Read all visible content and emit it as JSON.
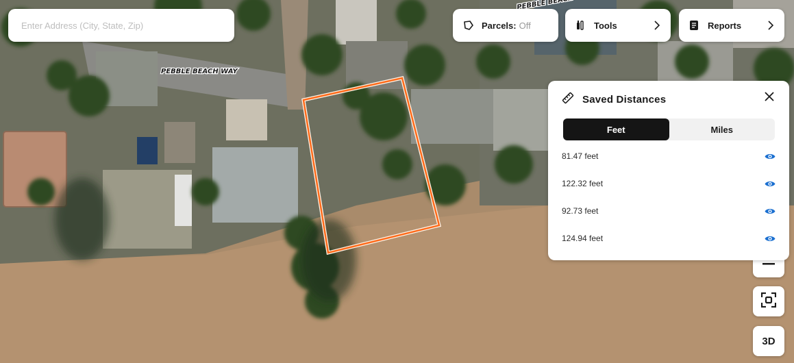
{
  "search": {
    "placeholder": "Enter Address (City, State, Zip)",
    "value": ""
  },
  "toolbar": {
    "parcels_label": "Parcels:",
    "parcels_state": "Off",
    "tools_label": "Tools",
    "reports_label": "Reports"
  },
  "map": {
    "street_label": "PEBBLE BEACH WAY",
    "street_label_2": "PEBBLE BEACH",
    "parcel_outline_color": "#ff6a1a"
  },
  "saved_distances": {
    "title": "Saved Distances",
    "units": [
      "Feet",
      "Miles"
    ],
    "active_unit": "Feet",
    "items": [
      {
        "label": "81.47 feet"
      },
      {
        "label": "122.32 feet"
      },
      {
        "label": "92.73 feet"
      },
      {
        "label": "124.94 feet"
      }
    ],
    "eye_icon_color": "#1a6fd0"
  },
  "map_controls": {
    "three_d_label": "3D"
  }
}
